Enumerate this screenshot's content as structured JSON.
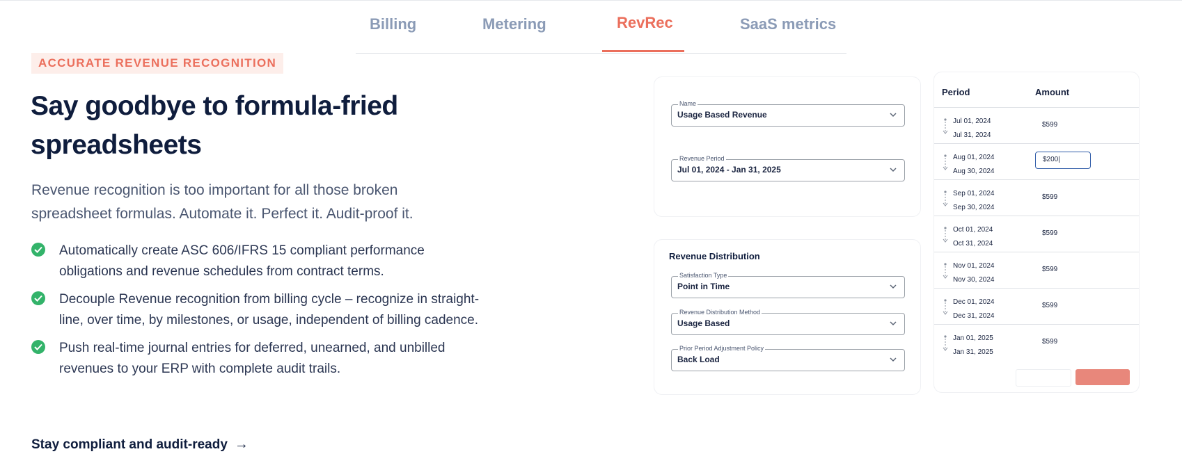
{
  "tabs": [
    {
      "label": "Billing"
    },
    {
      "label": "Metering"
    },
    {
      "label": "RevRec"
    },
    {
      "label": "SaaS metrics"
    }
  ],
  "active_tab": "RevRec",
  "hero": {
    "eyebrow": "ACCURATE REVENUE RECOGNITION",
    "headline_line1": "Say goodbye to formula-fried",
    "headline_line2": "spreadsheets",
    "lede": "Revenue recognition is too important for all those broken spreadsheet formulas. Automate it. Perfect it. Audit-proof it.",
    "bullets": [
      "Automatically create ASC 606/IFRS 15 compliant performance obligations and revenue schedules from contract terms.",
      "Decouple Revenue recognition from billing cycle – recognize in straight-line, over time, by milestones, or usage, independent of billing cadence.",
      "Push real-time journal entries for deferred, unearned, and unbilled revenues to your ERP with complete audit trails."
    ],
    "cta": "Stay compliant and audit-ready",
    "cta_arrow": "→"
  },
  "settings": {
    "name_label": "Name",
    "name_value": "Usage Based Revenue",
    "period_label": "Revenue Period",
    "period_value": "Jul 01, 2024 - Jan 31, 2025"
  },
  "distribution": {
    "title": "Revenue Distribution",
    "satisfaction_label": "Satisfaction Type",
    "satisfaction_value": "Point in Time",
    "method_label": "Revenue Distribution Method",
    "method_value": "Usage Based",
    "policy_label": "Prior Period Adjustment Policy",
    "policy_value": "Back Load"
  },
  "schedule": {
    "col_period": "Period",
    "col_amount": "Amount",
    "rows": [
      {
        "start": "Jul 01, 2024",
        "end": "Jul 31, 2024",
        "amount": "$599"
      },
      {
        "start": "Aug 01, 2024",
        "end": "Aug 30, 2024",
        "amount": "$200|",
        "editing": true
      },
      {
        "start": "Sep 01, 2024",
        "end": "Sep 30, 2024",
        "amount": "$599"
      },
      {
        "start": "Oct 01, 2024",
        "end": "Oct 31, 2024",
        "amount": "$599"
      },
      {
        "start": "Nov 01, 2024",
        "end": "Nov 30, 2024",
        "amount": "$599"
      },
      {
        "start": "Dec 01, 2024",
        "end": "Dec 31, 2024",
        "amount": "$599"
      },
      {
        "start": "Jan 01, 2025",
        "end": "Jan 31, 2025",
        "amount": "$599"
      }
    ]
  },
  "colors": {
    "accent": "#eb6f5c",
    "navy": "#0f1d3d",
    "tab_inactive": "#8b9bb6",
    "check_green": "#33b36a",
    "input_focus": "#2f5ca8"
  }
}
